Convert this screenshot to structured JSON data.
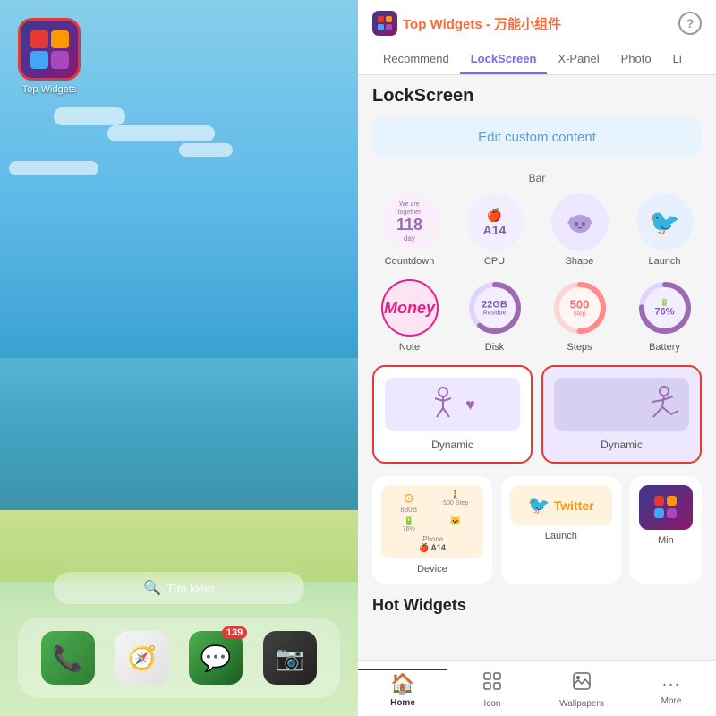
{
  "left": {
    "app_icon_label": "Top Widgets",
    "search_placeholder": "Tìm kiếm",
    "dock": {
      "items": [
        {
          "name": "phone",
          "label": "Phone",
          "icon": "📞",
          "bg_start": "#4CAF50",
          "bg_end": "#2E7D32",
          "badge": null
        },
        {
          "name": "safari",
          "label": "Safari",
          "icon": "🧭",
          "bg_start": "#F5F5F5",
          "bg_end": "#E0E0E0",
          "badge": null
        },
        {
          "name": "messages",
          "label": "Messages",
          "icon": "💬",
          "bg_start": "#4CAF50",
          "bg_end": "#1B5E20",
          "badge": "139"
        },
        {
          "name": "camera",
          "label": "Camera",
          "icon": "📷",
          "bg_start": "#424242",
          "bg_end": "#212121",
          "badge": null
        }
      ]
    }
  },
  "right": {
    "header": {
      "title": "Top Widgets",
      "subtitle": "万能小组件",
      "help_icon": "?"
    },
    "nav_tabs": [
      {
        "label": "Recommend",
        "active": false
      },
      {
        "label": "LockScreen",
        "active": true
      },
      {
        "label": "X-Panel",
        "active": false
      },
      {
        "label": "Photo",
        "active": false
      },
      {
        "label": "Li",
        "active": false
      }
    ],
    "section": "LockScreen",
    "edit_btn": "Edit custom content",
    "bar_label": "Bar",
    "widgets_row1": [
      {
        "id": "countdown",
        "label": "Countdown",
        "top": "We are together",
        "num": "118",
        "unit": "day"
      },
      {
        "id": "cpu",
        "label": "CPU",
        "text": "A14"
      },
      {
        "id": "shape",
        "label": "Shape"
      },
      {
        "id": "launch",
        "label": "Launch"
      }
    ],
    "widgets_row2": [
      {
        "id": "note",
        "label": "Note",
        "text": "Money"
      },
      {
        "id": "disk",
        "label": "Disk",
        "num": "22GB",
        "sub": "Residue"
      },
      {
        "id": "steps",
        "label": "Steps",
        "num": "500",
        "sub": "Step"
      },
      {
        "id": "battery",
        "label": "Battery",
        "text": "76%"
      }
    ],
    "dynamic_widgets": [
      {
        "label": "Dynamic"
      },
      {
        "label": "Dynamic"
      }
    ],
    "misc_row": [
      {
        "label": "Device",
        "sub1": "830B",
        "sub2": "iPhone",
        "sub3": "A14"
      },
      {
        "label": "Launch",
        "text": "Twitter"
      },
      {
        "label": "Min"
      }
    ],
    "hot_title": "Hot Widgets",
    "bottom_nav": [
      {
        "label": "Home",
        "icon": "🏠",
        "active": true
      },
      {
        "label": "Icon",
        "icon": "⊞",
        "active": false
      },
      {
        "label": "Wallpapers",
        "icon": "🖼",
        "active": false
      },
      {
        "label": "More",
        "icon": "···",
        "active": false
      }
    ]
  }
}
